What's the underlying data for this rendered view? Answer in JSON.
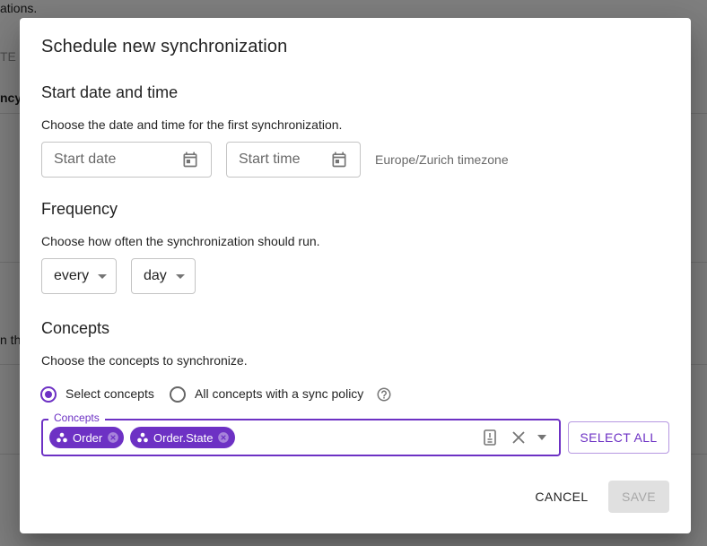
{
  "background": {
    "text_top": "ations.",
    "text_header": "TE",
    "text_col": "ncy",
    "text_row": "n th"
  },
  "dialog": {
    "title": "Schedule new synchronization",
    "start": {
      "heading": "Start date and time",
      "hint": "Choose the date and time for the first synchronization.",
      "date_placeholder": "Start date",
      "time_placeholder": "Start time",
      "timezone": "Europe/Zurich timezone"
    },
    "frequency": {
      "heading": "Frequency",
      "hint": "Choose how often the synchronization should run.",
      "interval_value": "every",
      "unit_value": "day"
    },
    "concepts": {
      "heading": "Concepts",
      "hint": "Choose the concepts to synchronize.",
      "radio_select": "Select concepts",
      "radio_all": "All concepts with a sync policy",
      "selected_option": "Select concepts",
      "field_label": "Concepts",
      "chips": [
        "Order",
        "Order.State"
      ],
      "select_all_label": "SELECT ALL"
    },
    "actions": {
      "cancel_label": "CANCEL",
      "save_label": "SAVE"
    }
  },
  "colors": {
    "accent": "#6d31c4",
    "scrim": "rgba(0,0,0,0.5)"
  },
  "icons": {
    "date": "calendar-icon",
    "time": "calendar-icon",
    "help": "help-circle-icon",
    "chip": "concept-icon",
    "chip_delete": "cancel-circle-icon",
    "list": "list-icon",
    "clear": "close-icon",
    "dropdown": "arrow-drop-down-icon"
  }
}
